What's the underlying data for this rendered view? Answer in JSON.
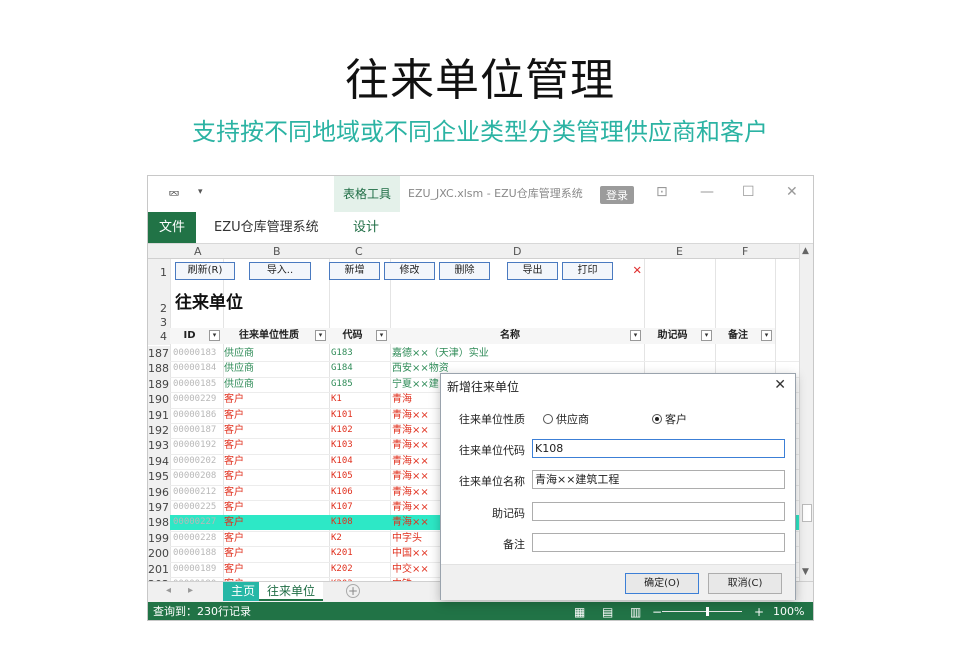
{
  "headline": "往来单位管理",
  "subheadline": "支持按不同地域或不同企业类型分类管理供应商和客户",
  "window": {
    "table_tools": "表格工具",
    "file_name": "EZU_JXC.xlsm  -  EZU仓库管理系统",
    "login": "登录",
    "qa_arrow": "▾",
    "ctl_restore": "⊡",
    "ctl_min": "—",
    "ctl_max": "☐",
    "ctl_close": "✕"
  },
  "ribbon": {
    "file": "文件",
    "system": "EZU仓库管理系统",
    "design": "设计"
  },
  "sheet": {
    "columns": [
      "A",
      "B",
      "C",
      "D",
      "E",
      "F"
    ],
    "rows_top": [
      "1",
      "2",
      "3",
      "4"
    ],
    "buttons": [
      "刷新(R)",
      "导入..",
      "新增",
      "修改",
      "删除",
      "导出",
      "打印"
    ],
    "close_x": "✕",
    "title": "往来单位",
    "headers": [
      "ID",
      "往来单位性质",
      "代码",
      "名称",
      "助记码",
      "备注"
    ],
    "dropdown": "▾",
    "rows": [
      {
        "num": "187",
        "id": "00000183",
        "type": "供应商",
        "code": "G183",
        "name": "嘉德××（天津）实业"
      },
      {
        "num": "188",
        "id": "00000184",
        "type": "供应商",
        "code": "G184",
        "name": "西安××物资"
      },
      {
        "num": "189",
        "id": "00000185",
        "type": "供应商",
        "code": "G185",
        "name": "宁夏××建"
      },
      {
        "num": "190",
        "id": "00000229",
        "type": "客户",
        "code": "K1",
        "name": "青海"
      },
      {
        "num": "191",
        "id": "00000186",
        "type": "客户",
        "code": "K101",
        "name": "  青海××"
      },
      {
        "num": "192",
        "id": "00000187",
        "type": "客户",
        "code": "K102",
        "name": "  青海××"
      },
      {
        "num": "193",
        "id": "00000192",
        "type": "客户",
        "code": "K103",
        "name": "  青海××"
      },
      {
        "num": "194",
        "id": "00000202",
        "type": "客户",
        "code": "K104",
        "name": "  青海××"
      },
      {
        "num": "195",
        "id": "00000208",
        "type": "客户",
        "code": "K105",
        "name": "  青海××"
      },
      {
        "num": "196",
        "id": "00000212",
        "type": "客户",
        "code": "K106",
        "name": "  青海××"
      },
      {
        "num": "197",
        "id": "00000225",
        "type": "客户",
        "code": "K107",
        "name": "  青海××"
      },
      {
        "num": "198",
        "id": "00000227",
        "type": "客户",
        "code": "K108",
        "name": "  青海××"
      },
      {
        "num": "199",
        "id": "00000228",
        "type": "客户",
        "code": "K2",
        "name": "中字头"
      },
      {
        "num": "200",
        "id": "00000188",
        "type": "客户",
        "code": "K201",
        "name": "  中国××"
      },
      {
        "num": "201",
        "id": "00000189",
        "type": "客户",
        "code": "K202",
        "name": "  中交××"
      },
      {
        "num": "202",
        "id": "00000190",
        "type": "客户",
        "code": "K203",
        "name": "  中铁××"
      }
    ],
    "selected_row": 11
  },
  "tabs": {
    "nav_prev": "◂",
    "nav_next": "▸",
    "home": "主页",
    "current": "往来单位",
    "add": "+"
  },
  "status": {
    "text": "查询到：230行记录",
    "zoom": "100%",
    "minus": "−",
    "plus": "+"
  },
  "scroll": {
    "up": "▲",
    "down": "▼"
  },
  "dialog": {
    "title": "新增往来单位",
    "close": "✕",
    "type_label": "往来单位性质",
    "opt_supplier": "供应商",
    "opt_customer": "客户",
    "selected": "客户",
    "code_label": "往来单位代码",
    "code_value": "K108",
    "name_label": "往来单位名称",
    "name_value": "青海××建筑工程",
    "mnemonic_label": "助记码",
    "mnemonic_value": "",
    "remark_label": "备注",
    "remark_value": "",
    "ok": "确定(O)",
    "cancel": "取消(C)"
  },
  "colors": {
    "supplier": "#2e8b57",
    "customer": "#e0301e",
    "accent": "#217346",
    "teal": "#2bb3a3",
    "selected_row": "#2de8c6"
  }
}
